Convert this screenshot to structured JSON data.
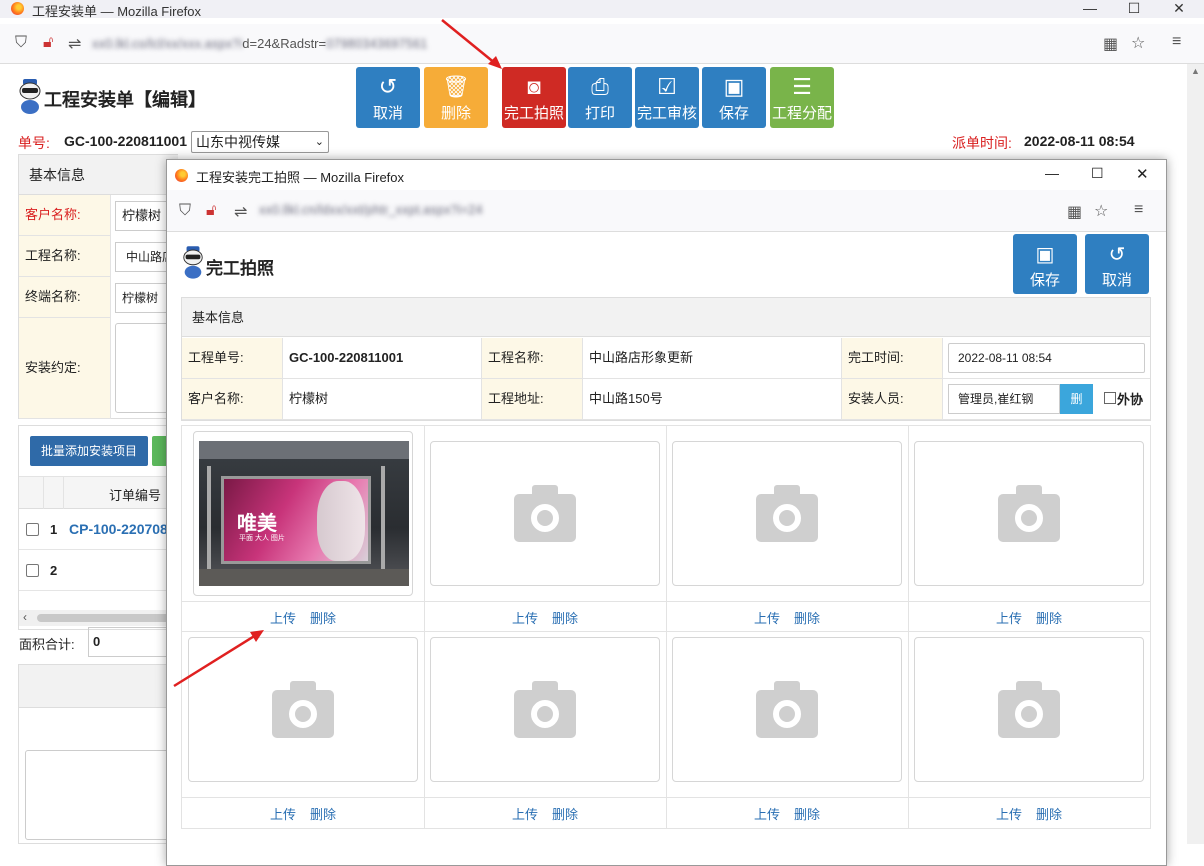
{
  "outer": {
    "window_title": "工程安装单 — Mozilla Firefox",
    "url_visible": "d=24&Radstr=",
    "page_title": "工程安装单【编辑】",
    "toolbar": [
      {
        "label": "取消",
        "glyph": "↺",
        "color": "#2f7fc1"
      },
      {
        "label": "删除",
        "glyph": "🗑",
        "color": "#f6ac38"
      },
      {
        "label": "完工拍照",
        "glyph": "📷",
        "color": "#cf2a24"
      },
      {
        "label": "打印",
        "glyph": "⎙",
        "color": "#2f7fc1"
      },
      {
        "label": "完工审核",
        "glyph": "☑",
        "color": "#2f7fc1"
      },
      {
        "label": "保存",
        "glyph": "💾",
        "color": "#2f7fc1"
      },
      {
        "label": "工程分配",
        "glyph": "☰",
        "color": "#79b44a"
      }
    ],
    "order_label": "单号:",
    "order_no": "GC-100-220811001",
    "customer_select": "山东中视传媒",
    "dispatch_label": "派单时间:",
    "dispatch_time": "2022-08-11 08:54",
    "basic_info": "基本信息",
    "fields": [
      {
        "label": "客户名称:",
        "value": "柠檬树"
      },
      {
        "label": "工程名称:",
        "value": "中山路店"
      },
      {
        "label": "终端名称:",
        "value": "柠檬树"
      },
      {
        "label": "安装约定:",
        "value": ""
      }
    ],
    "batch_button": "批量添加安装项目",
    "table_header": "订单编号",
    "rows": [
      {
        "index": "1",
        "order": "CP-100-220708"
      },
      {
        "index": "2",
        "order": ""
      }
    ],
    "area_label": "面积合计:",
    "area_value": "0"
  },
  "popup": {
    "window_title": "工程安装完工拍照 — Mozilla Firefox",
    "title": "完工拍照",
    "save_label": "保存",
    "cancel_label": "取消",
    "basic_info": "基本信息",
    "info": {
      "order_no_label": "工程单号:",
      "order_no": "GC-100-220811001",
      "project_name_label": "工程名称:",
      "project_name": "中山路店形象更新",
      "finish_time_label": "完工时间:",
      "finish_time": "2022-08-11 08:54",
      "customer_label": "客户名称:",
      "customer": "柠檬树",
      "address_label": "工程地址:",
      "address": "中山路150号",
      "installer_label": "安装人员:",
      "installer": "管理员,崔红钢",
      "delete_btn": "删",
      "outsource_label": "外协"
    },
    "upload_label": "上传",
    "delete_label": "删除",
    "photo_ad_text": "唯美",
    "photo_ad_sub": "平面 大人 图片"
  },
  "colors": {
    "blue": "#2f7fc1",
    "orange": "#f6ac38",
    "red": "#cf2a24",
    "green": "#79b44a",
    "cream": "#fdf8e7",
    "link": "#2a6fb3"
  }
}
